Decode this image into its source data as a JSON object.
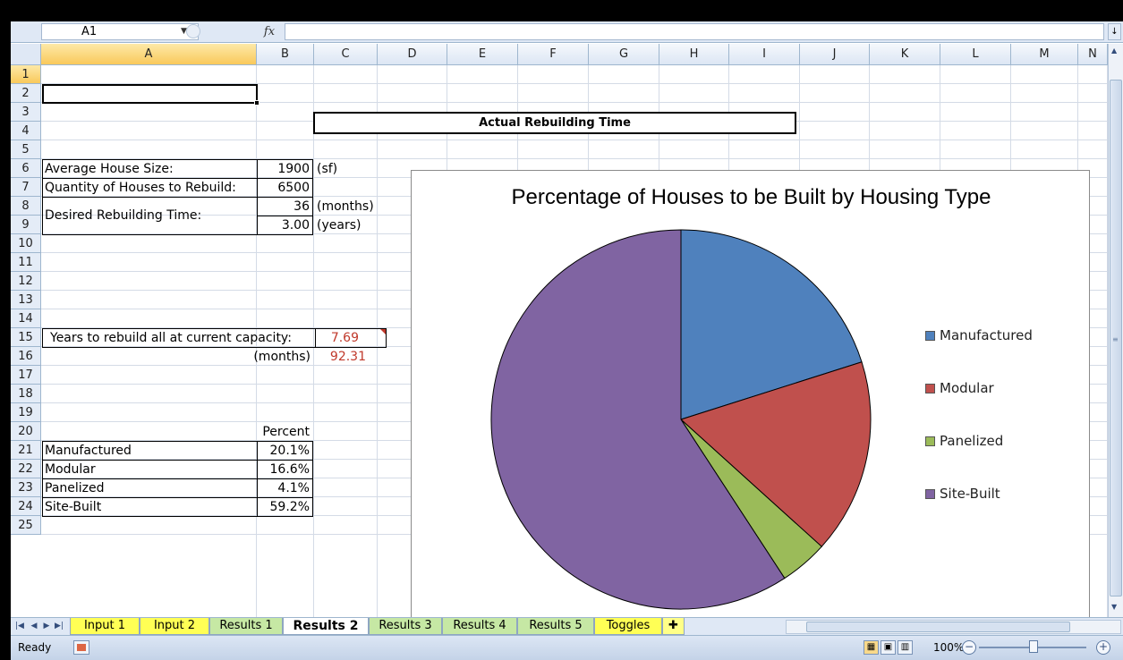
{
  "formula_bar": {
    "name_box": "A1",
    "fx": "fx",
    "formula": ""
  },
  "columns": [
    "A",
    "B",
    "C",
    "D",
    "E",
    "F",
    "G",
    "H",
    "I",
    "J",
    "K",
    "L",
    "M",
    "N"
  ],
  "rows": [
    "1",
    "2",
    "3",
    "4",
    "5",
    "6",
    "7",
    "8",
    "9",
    "10",
    "11",
    "12",
    "13",
    "14",
    "15",
    "16",
    "17",
    "18",
    "19",
    "20",
    "21",
    "22",
    "23",
    "24",
    "25"
  ],
  "sheet": {
    "title": "Actual Rebuilding Time",
    "avg_house_size_label": "Average House Size:",
    "avg_house_size_value": "1900",
    "avg_house_size_unit": "(sf)",
    "qty_label": "Quantity of Houses to Rebuild:",
    "qty_value": "6500",
    "desired_label": "Desired Rebuilding Time:",
    "desired_months_value": "36",
    "desired_months_unit": "(months)",
    "desired_years_value": "3.00",
    "desired_years_unit": "(years)",
    "years_rebuild_label": "Years to rebuild all at current capacity:",
    "years_rebuild_value": "7.69",
    "months_label": "(months)",
    "months_value": "92.31",
    "percent_header": "Percent",
    "types": [
      {
        "name": "Manufactured",
        "percent": "20.1%"
      },
      {
        "name": "Modular",
        "percent": "16.6%"
      },
      {
        "name": "Panelized",
        "percent": "4.1%"
      },
      {
        "name": "Site-Built",
        "percent": "59.2%"
      }
    ]
  },
  "chart_data": {
    "type": "pie",
    "title": "Percentage of Houses to be Built by Housing Type",
    "categories": [
      "Manufactured",
      "Modular",
      "Panelized",
      "Site-Built"
    ],
    "values": [
      20.1,
      16.6,
      4.1,
      59.2
    ],
    "colors": [
      "#4f81bd",
      "#c0504d",
      "#9bbb59",
      "#8064a2"
    ],
    "legend": "right"
  },
  "tabs": [
    {
      "label": "Input 1",
      "color": "yellow"
    },
    {
      "label": "Input 2",
      "color": "yellow"
    },
    {
      "label": "Results 1",
      "color": "green"
    },
    {
      "label": "Results 2",
      "color": "active"
    },
    {
      "label": "Results 3",
      "color": "green"
    },
    {
      "label": "Results 4",
      "color": "green"
    },
    {
      "label": "Results 5",
      "color": "green"
    },
    {
      "label": "Toggles",
      "color": "yellow"
    }
  ],
  "status": {
    "ready": "Ready",
    "zoom": "100%"
  },
  "icons": {
    "fx": "function-icon",
    "dropdown": "chevron-down-icon",
    "macro": "macro-record-icon"
  }
}
